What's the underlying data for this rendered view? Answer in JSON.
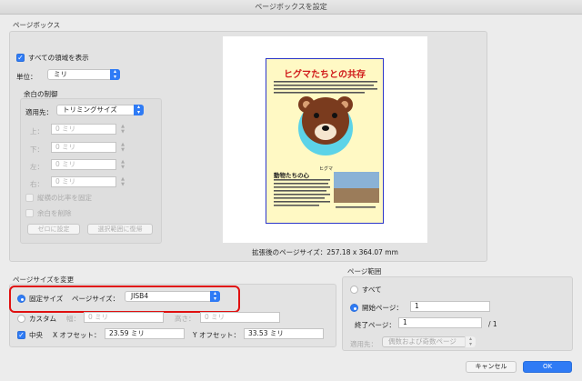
{
  "window": {
    "title": "ページボックスを設定"
  },
  "page_box": {
    "section_label": "ページボックス",
    "show_all_label": "すべての領域を表示",
    "unit_label": "単位：",
    "unit_value": "ミリ",
    "margin_control": {
      "label": "余白の制御",
      "apply_to_label": "適用先：",
      "apply_to_value": "トリミングサイズ",
      "top_label": "上：",
      "bottom_label": "下：",
      "left_label": "左：",
      "right_label": "右：",
      "top_value": "0 ミリ",
      "bottom_value": "0 ミリ",
      "left_value": "0 ミリ",
      "right_value": "0 ミリ",
      "constrain_label": "縦横の比率を固定",
      "remove_white_label": "余白を削除",
      "set_zero_label": "ゼロに設定",
      "revert_label": "選択範囲に復帰"
    },
    "preview": {
      "poster_title": "ヒグマたちとの共存",
      "bear_caption": "ヒグマ",
      "sub_heading": "動物たちの心",
      "size_label": "拡張後のページサイズ：257.18 x 364.07 mm"
    }
  },
  "page_size": {
    "section_label": "ページサイズを変更",
    "fixed_label": "固定サイズ",
    "page_size_label": "ページサイズ：",
    "page_size_value": "JISB4",
    "custom_label": "カスタム",
    "width_label": "幅：",
    "width_value": "0 ミリ",
    "height_label": "高さ：",
    "height_value": "0 ミリ",
    "center_label": "中央",
    "x_offset_label": "X オフセット：",
    "x_offset_value": "23.59 ミリ",
    "y_offset_label": "Y オフセット：",
    "y_offset_value": "33.53 ミリ"
  },
  "page_range": {
    "section_label": "ページ範囲",
    "all_label": "すべて",
    "start_label": "開始ページ：",
    "start_value": "1",
    "end_label": "終了ページ：",
    "end_value": "1",
    "total": "/ 1",
    "apply_to_label": "適用先：",
    "apply_to_value": "偶数および奇数ページ"
  },
  "buttons": {
    "cancel": "キャンセル",
    "ok": "OK"
  },
  "colors": {
    "accent": "#2f7bf5",
    "highlight": "#e01010"
  }
}
